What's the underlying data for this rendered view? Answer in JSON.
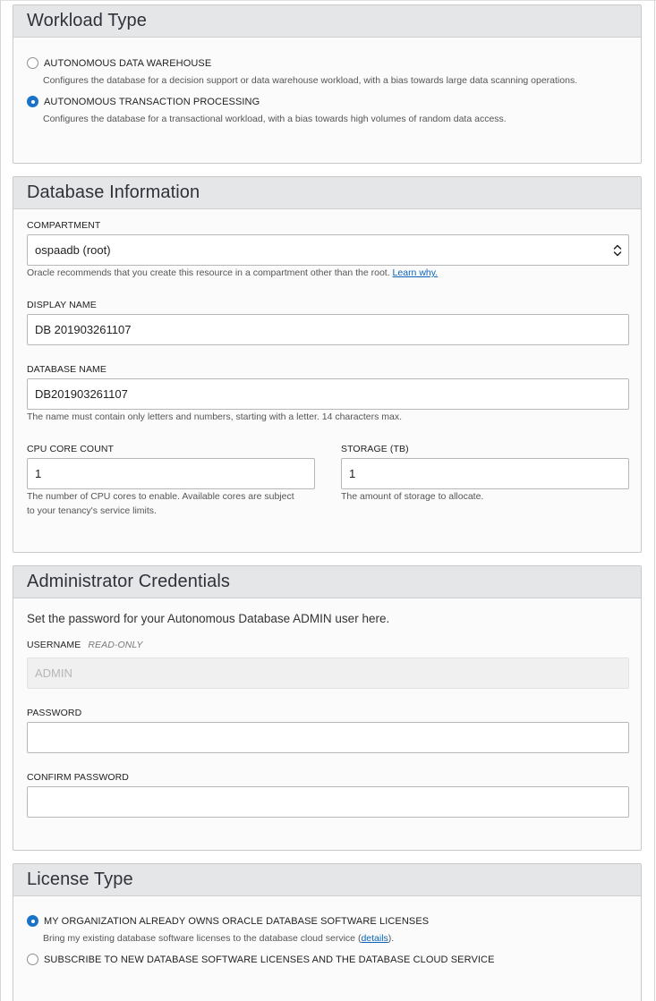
{
  "workload": {
    "title": "Workload Type",
    "options": [
      {
        "label": "AUTONOMOUS DATA WAREHOUSE",
        "description": "Configures the database for a decision support or data warehouse workload, with a bias towards large data scanning operations.",
        "selected": false
      },
      {
        "label": "AUTONOMOUS TRANSACTION PROCESSING",
        "description": "Configures the database for a transactional workload, with a bias towards high volumes of random data access.",
        "selected": true
      }
    ]
  },
  "database_info": {
    "title": "Database Information",
    "compartment": {
      "label": "COMPARTMENT",
      "value": "ospaadb (root)",
      "help": "Oracle recommends that you create this resource in a compartment other than the root.",
      "help_link": "Learn why."
    },
    "display_name": {
      "label": "DISPLAY NAME",
      "value": "DB 201903261107"
    },
    "database_name": {
      "label": "DATABASE NAME",
      "value": "DB201903261107",
      "help": "The name must contain only letters and numbers, starting with a letter. 14 characters max."
    },
    "cpu_core_count": {
      "label": "CPU CORE COUNT",
      "value": "1",
      "help_line1": "The number of CPU cores to enable. Available cores are subject",
      "help_line2": "to your tenancy's service limits."
    },
    "storage": {
      "label": "STORAGE (TB)",
      "value": "1",
      "help": "The amount of storage to allocate."
    }
  },
  "admin": {
    "title": "Administrator Credentials",
    "intro": "Set the password for your Autonomous Database ADMIN user here.",
    "username": {
      "label": "USERNAME",
      "tag": "READ-ONLY",
      "value": "ADMIN"
    },
    "password": {
      "label": "PASSWORD",
      "value": ""
    },
    "confirm_password": {
      "label": "CONFIRM PASSWORD",
      "value": ""
    }
  },
  "license": {
    "title": "License Type",
    "option1": {
      "label": "MY ORGANIZATION ALREADY OWNS ORACLE DATABASE SOFTWARE LICENSES",
      "desc_prefix": "Bring my existing database software licenses to the database cloud service (",
      "desc_link": "details",
      "desc_suffix": ").",
      "selected": true
    },
    "option2": {
      "label": "SUBSCRIBE TO NEW DATABASE SOFTWARE LICENSES AND THE DATABASE CLOUD SERVICE",
      "selected": false
    }
  },
  "colors": {
    "accent": "#1a73c7",
    "link": "#0a63b8",
    "panel_header": "#e4e6e8"
  }
}
